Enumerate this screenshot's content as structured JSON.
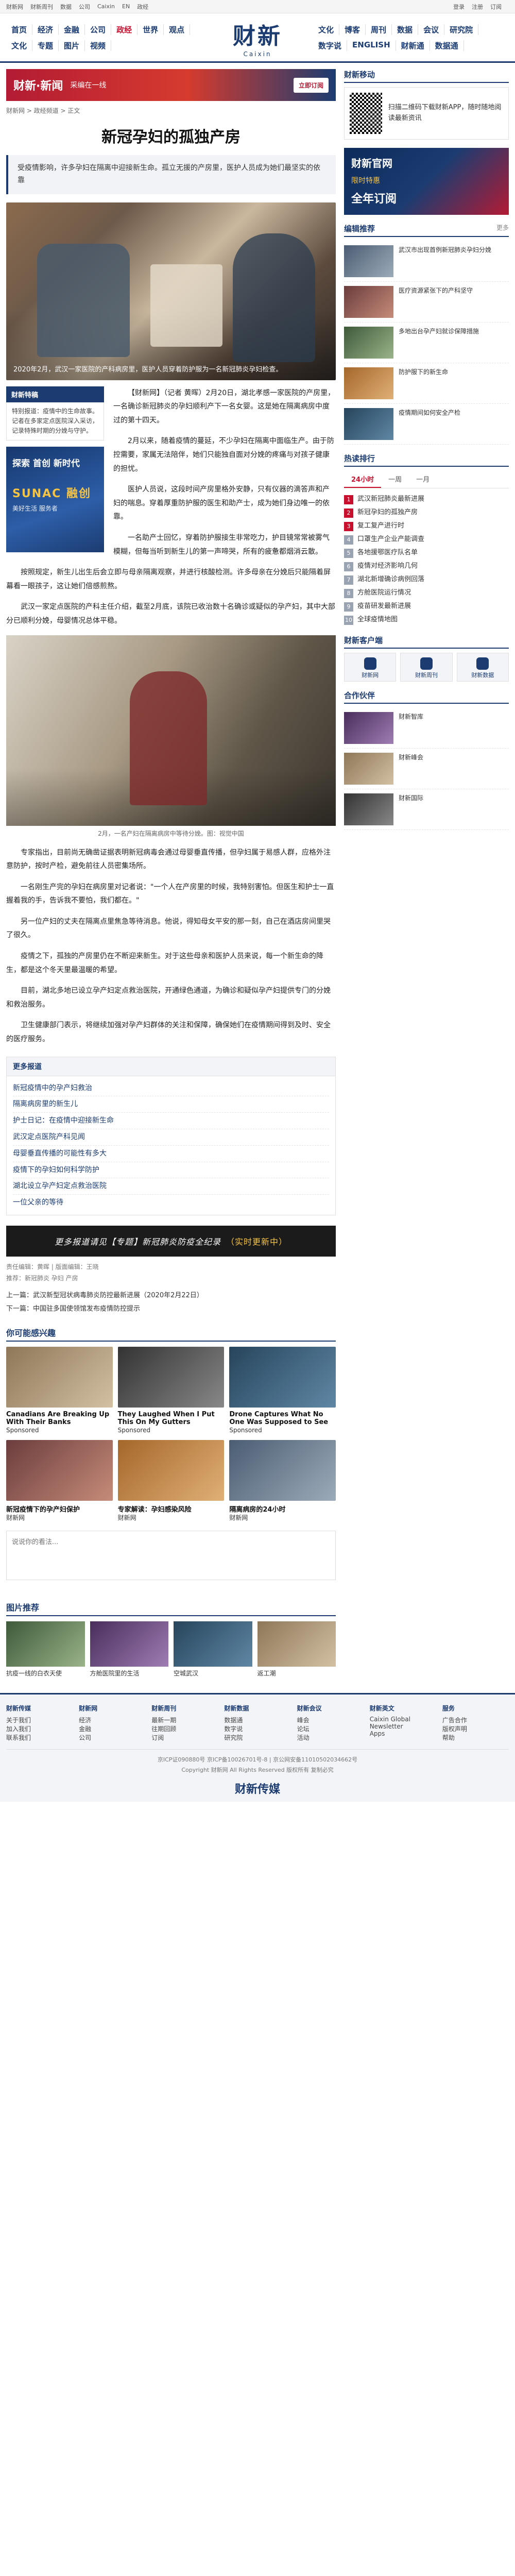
{
  "topbar": {
    "links": [
      "财新网",
      "财新周刊",
      "数据",
      "公司",
      "Caixin",
      "EN",
      "政经"
    ],
    "right": [
      "登录",
      "注册",
      "订阅"
    ]
  },
  "nav": {
    "left": [
      "首页",
      "经济",
      "金融",
      "公司",
      "政经",
      "世界",
      "观点",
      "文化",
      "专题",
      "图片",
      "视频"
    ],
    "right": [
      "文化",
      "博客",
      "周刊",
      "数据",
      "会议",
      "研究院",
      "数字说",
      "ENGLISH",
      "财新通",
      "数据通"
    ],
    "active": "政经",
    "logo_cn": "财新",
    "logo_en": "Caixin"
  },
  "top_ad": {
    "big": "财新·新闻",
    "mid": "采编在一线",
    "btn": "立即订阅"
  },
  "breadcrumb": "财新网 > 政经频道 > 正文",
  "article": {
    "title": "新冠孕妇的孤独产房",
    "summary": "受疫情影响，许多孕妇在隔离中迎接新生命。孤立无援的产房里，医护人员成为她们最坚实的依靠",
    "hero_caption": "2020年2月，武汉一家医院的产科病房里，医护人员穿着防护服为一名新冠肺炎孕妇检查。",
    "card_title": "财新特稿",
    "card_body": "特别报道：疫情中的生命故事。记者在多家定点医院深入采访，记录特殊时期的分娩与守护。",
    "promo_1": "探索 首创 新时代",
    "promo_2": "SUNAC 融创",
    "promo_3": "美好生活 服务者",
    "paragraphs": [
      "【财新网】（记者 黄晖）2月20日，湖北孝感一家医院的产房里，一名确诊新冠肺炎的孕妇顺利产下一名女婴。这是她在隔离病房中度过的第十四天。",
      "2月以来，随着疫情的蔓延，不少孕妇在隔离中面临生产。由于防控需要，家属无法陪伴，她们只能独自面对分娩的疼痛与对孩子健康的担忧。",
      "医护人员说，这段时间产房里格外安静，只有仪器的滴答声和产妇的喘息。穿着厚重防护服的医生和助产士，成为她们身边唯一的依靠。",
      "一名助产士回忆，穿着防护服接生非常吃力，护目镜常常被雾气模糊，但每当听到新生儿的第一声啼哭，所有的疲惫都烟消云散。",
      "按照规定，新生儿出生后会立即与母亲隔离观察，并进行核酸检测。许多母亲在分娩后只能隔着屏幕看一眼孩子，这让她们倍感煎熬。",
      "武汉一家定点医院的产科主任介绍，截至2月底，该院已收治数十名确诊或疑似的孕产妇，其中大部分已顺利分娩，母婴情况总体平稳。",
      "专家指出，目前尚无确凿证据表明新冠病毒会通过母婴垂直传播，但孕妇属于易感人群，应格外注意防护，按时产检，避免前往人员密集场所。",
      "一名刚生产完的孕妇在病房里对记者说：\"一个人在产房里的时候，我特别害怕。但医生和护士一直握着我的手，告诉我不要怕，我们都在。\"",
      "另一位产妇的丈夫在隔离点里焦急等待消息。他说，得知母女平安的那一刻，自己在酒店房间里哭了很久。",
      "疫情之下，孤独的产房里仍在不断迎来新生。对于这些母亲和医护人员来说，每一个新生命的降生，都是这个冬天里最温暖的希望。",
      "目前，湖北多地已设立孕产妇定点救治医院，开通绿色通道，为确诊和疑似孕产妇提供专门的分娩和救治服务。",
      "卫生健康部门表示，将继续加强对孕产妇群体的关注和保障，确保她们在疫情期间得到及时、安全的医疗服务。"
    ],
    "inline_caption": "2月，一名产妇在隔离病房中等待分娩。图：视觉中国"
  },
  "related": {
    "title": "更多报道",
    "items": [
      "新冠疫情中的孕产妇救治",
      "隔离病房里的新生儿",
      "护士日记：在疫情中迎接新生命",
      "武汉定点医院产科见闻",
      "母婴垂直传播的可能性有多大",
      "疫情下的孕妇如何科学防护",
      "湖北设立孕产妇定点救治医院",
      "一位父亲的等待"
    ]
  },
  "bottom_ad": {
    "text": "更多报道请见【专题】新冠肺炎防疫全纪录",
    "highlight": "（实时更新中）"
  },
  "meta": {
    "editor": "责任编辑：黄晖 | 版面编辑：王晓",
    "tags": "推荐：新冠肺炎 孕妇 产房"
  },
  "prev_next": {
    "prev": "上一篇：武汉新型冠状病毒肺炎防控最新进展（2020年2月22日）",
    "next": "下一篇：中国驻多国使领馆发布疫情防控提示"
  },
  "recommend": {
    "title": "你可能感兴趣",
    "items": [
      {
        "title": "Canadians Are Breaking Up With Their Banks",
        "sub": "Sponsored"
      },
      {
        "title": "They Laughed When I Put This On My Gutters",
        "sub": "Sponsored"
      },
      {
        "title": "Drone Captures What No One Was Supposed to See",
        "sub": "Sponsored"
      },
      {
        "title": "新冠疫情下的孕产妇保护",
        "sub": "财新网"
      },
      {
        "title": "专家解读：孕妇感染风险",
        "sub": "财新网"
      },
      {
        "title": "隔离病房的24小时",
        "sub": "财新网"
      }
    ]
  },
  "comment": {
    "placeholder": "说说你的看法..."
  },
  "gallery": {
    "title": "图片推荐",
    "items": [
      "抗疫一线的白衣天使",
      "方舱医院里的生活",
      "空城武汉",
      "返工潮"
    ]
  },
  "sidebar": {
    "qr_title": "财新移动",
    "qr_text": "扫描二维码下载财新APP，随时随地阅读最新资讯",
    "banner_1": "财新官网",
    "banner_2": "限时特惠",
    "banner_3": "全年订阅",
    "news_title": "编辑推荐",
    "news_more": "更多",
    "news": [
      "武汉市出现首例新冠肺炎孕妇分娩",
      "医疗资源紧张下的产科坚守",
      "多地出台孕产妇就诊保障措施",
      "防护服下的新生命",
      "疫情期间如何安全产检"
    ],
    "rank_title": "热读排行",
    "tabs": [
      "24小时",
      "一周",
      "一月"
    ],
    "rank": [
      "武汉新冠肺炎最新进展",
      "新冠孕妇的孤独产房",
      "复工复产进行时",
      "口罩生产企业产能调查",
      "各地援鄂医疗队名单",
      "疫情对经济影响几何",
      "湖北新增确诊病例回落",
      "方舱医院运行情况",
      "疫苗研发最新进展",
      "全球疫情地图"
    ],
    "app_title": "财新客户端",
    "apps": [
      "财新网",
      "财新周刊",
      "财新数据"
    ],
    "ad_title": "合作伙伴",
    "ad_items": [
      "财新智库",
      "财新峰会",
      "财新国际"
    ]
  },
  "footer": {
    "cols": [
      {
        "title": "财新传媒",
        "items": [
          "关于我们",
          "加入我们",
          "联系我们"
        ]
      },
      {
        "title": "财新网",
        "items": [
          "经济",
          "金融",
          "公司"
        ]
      },
      {
        "title": "财新周刊",
        "items": [
          "最新一期",
          "往期回顾",
          "订阅"
        ]
      },
      {
        "title": "财新数据",
        "items": [
          "数据通",
          "数字说",
          "研究院"
        ]
      },
      {
        "title": "财新会议",
        "items": [
          "峰会",
          "论坛",
          "活动"
        ]
      },
      {
        "title": "财新英文",
        "items": [
          "Caixin Global",
          "Newsletter",
          "Apps"
        ]
      },
      {
        "title": "服务",
        "items": [
          "广告合作",
          "版权声明",
          "帮助"
        ]
      }
    ],
    "copyright": "京ICP证090880号 京ICP备10026701号-8 | 京公网安备11010502034662号",
    "copyright2": "Copyright 财新网 All Rights Reserved 版权所有 复制必究",
    "logo": "财新传媒"
  }
}
